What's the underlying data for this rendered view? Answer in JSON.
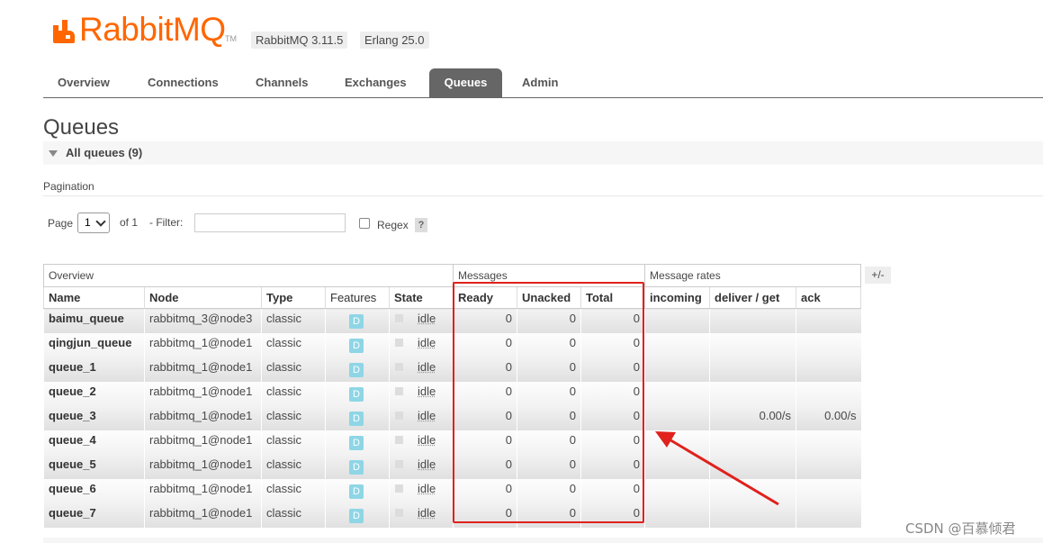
{
  "header": {
    "logo_text": "RabbitMQ",
    "logo_tm": "TM",
    "version_badges": [
      "RabbitMQ 3.11.5",
      "Erlang 25.0"
    ]
  },
  "tabs": [
    {
      "label": "Overview",
      "active": false
    },
    {
      "label": "Connections",
      "active": false
    },
    {
      "label": "Channels",
      "active": false
    },
    {
      "label": "Exchanges",
      "active": false
    },
    {
      "label": "Queues",
      "active": true
    },
    {
      "label": "Admin",
      "active": false
    }
  ],
  "page_title": "Queues",
  "section_title": "All queues (9)",
  "pagination": {
    "title": "Pagination",
    "page_label": "Page",
    "page_value": "1",
    "of_label": "of 1",
    "filter_label": "- Filter:",
    "filter_value": "",
    "regex_label": "Regex",
    "regex_checked": false,
    "help": "?"
  },
  "table": {
    "groups": [
      "Overview",
      "Messages",
      "Message rates"
    ],
    "columns": [
      "Name",
      "Node",
      "Type",
      "Features",
      "State",
      "Ready",
      "Unacked",
      "Total",
      "incoming",
      "deliver / get",
      "ack"
    ],
    "rows": [
      {
        "name": "baimu_queue",
        "node": "rabbitmq_3@node3",
        "type": "classic",
        "feature": "D",
        "state": "idle",
        "ready": "0",
        "unacked": "0",
        "total": "0",
        "incoming": "",
        "deliver_get": "",
        "ack": ""
      },
      {
        "name": "qingjun_queue",
        "node": "rabbitmq_1@node1",
        "type": "classic",
        "feature": "D",
        "state": "idle",
        "ready": "0",
        "unacked": "0",
        "total": "0",
        "incoming": "",
        "deliver_get": "",
        "ack": ""
      },
      {
        "name": "queue_1",
        "node": "rabbitmq_1@node1",
        "type": "classic",
        "feature": "D",
        "state": "idle",
        "ready": "0",
        "unacked": "0",
        "total": "0",
        "incoming": "",
        "deliver_get": "",
        "ack": ""
      },
      {
        "name": "queue_2",
        "node": "rabbitmq_1@node1",
        "type": "classic",
        "feature": "D",
        "state": "idle",
        "ready": "0",
        "unacked": "0",
        "total": "0",
        "incoming": "",
        "deliver_get": "",
        "ack": ""
      },
      {
        "name": "queue_3",
        "node": "rabbitmq_1@node1",
        "type": "classic",
        "feature": "D",
        "state": "idle",
        "ready": "0",
        "unacked": "0",
        "total": "0",
        "incoming": "",
        "deliver_get": "0.00/s",
        "ack": "0.00/s"
      },
      {
        "name": "queue_4",
        "node": "rabbitmq_1@node1",
        "type": "classic",
        "feature": "D",
        "state": "idle",
        "ready": "0",
        "unacked": "0",
        "total": "0",
        "incoming": "",
        "deliver_get": "",
        "ack": ""
      },
      {
        "name": "queue_5",
        "node": "rabbitmq_1@node1",
        "type": "classic",
        "feature": "D",
        "state": "idle",
        "ready": "0",
        "unacked": "0",
        "total": "0",
        "incoming": "",
        "deliver_get": "",
        "ack": ""
      },
      {
        "name": "queue_6",
        "node": "rabbitmq_1@node1",
        "type": "classic",
        "feature": "D",
        "state": "idle",
        "ready": "0",
        "unacked": "0",
        "total": "0",
        "incoming": "",
        "deliver_get": "",
        "ack": ""
      },
      {
        "name": "queue_7",
        "node": "rabbitmq_1@node1",
        "type": "classic",
        "feature": "D",
        "state": "idle",
        "ready": "0",
        "unacked": "0",
        "total": "0",
        "incoming": "",
        "deliver_get": "",
        "ack": ""
      }
    ],
    "column_toggle": "+/-"
  },
  "annotation": {
    "highlight_color": "#e0211c"
  },
  "watermark": "CSDN @百慕倾君",
  "colors": {
    "brand": "#ff6600",
    "active_tab": "#666666",
    "feature_badge": "#8ed6e6"
  }
}
